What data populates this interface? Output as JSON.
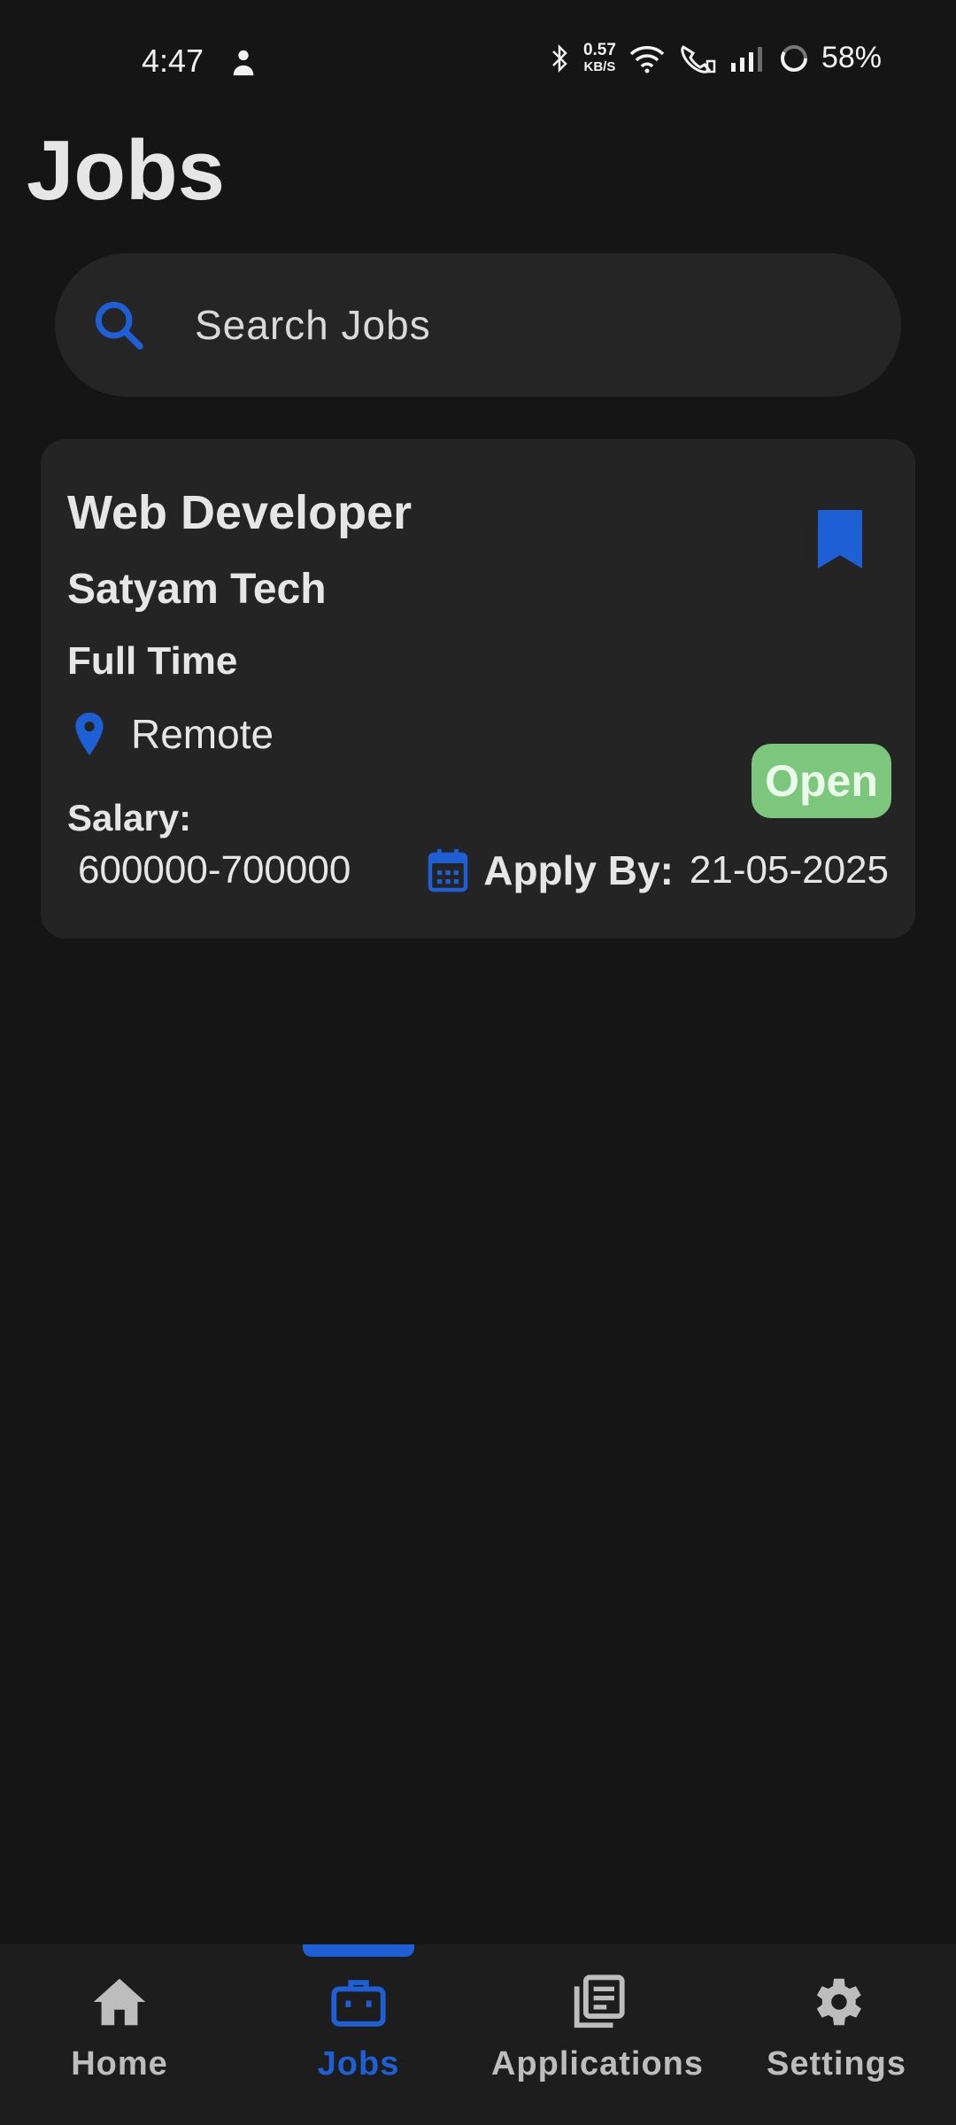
{
  "status_bar": {
    "time": "4:47",
    "speed_value": "0.57",
    "speed_unit": "KB/S",
    "battery": "58%"
  },
  "page": {
    "title": "Jobs"
  },
  "search": {
    "placeholder": "Search Jobs",
    "value": ""
  },
  "job": {
    "title": "Web Developer",
    "company": "Satyam Tech",
    "type": "Full Time",
    "location": "Remote",
    "status": "Open",
    "salary_label": "Salary:",
    "salary_value": "600000-700000",
    "apply_label": "Apply By:",
    "apply_date": "21-05-2025"
  },
  "nav": {
    "items": [
      {
        "label": "Home",
        "icon": "home-icon"
      },
      {
        "label": "Jobs",
        "icon": "briefcase-icon",
        "active": true
      },
      {
        "label": "Applications",
        "icon": "documents-icon"
      },
      {
        "label": "Settings",
        "icon": "gear-icon"
      }
    ]
  },
  "colors": {
    "accent": "#1f5fd6",
    "background": "#151515",
    "card": "#242424",
    "status_open": "#7cc67e"
  }
}
